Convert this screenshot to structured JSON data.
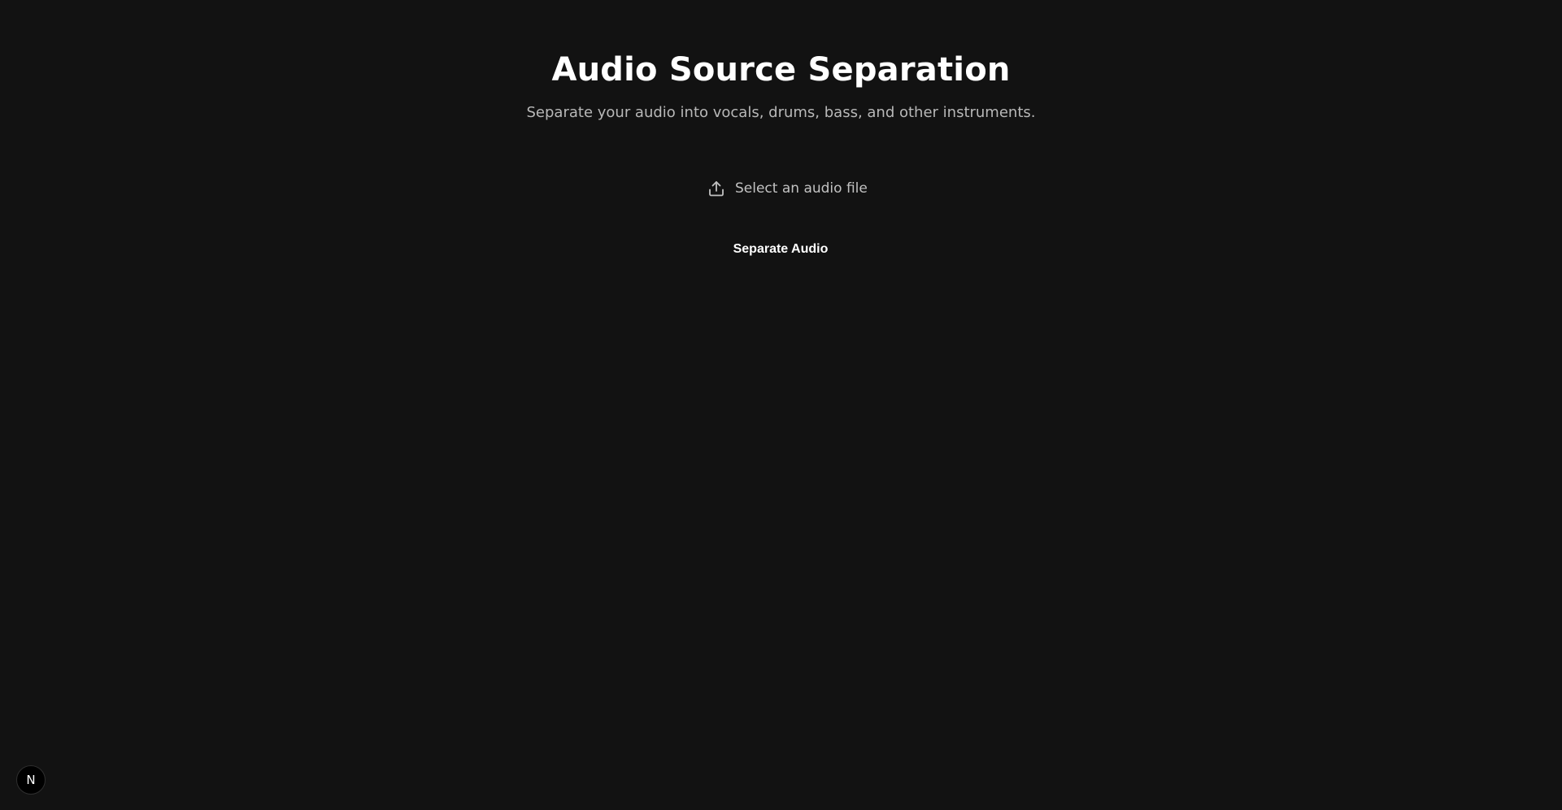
{
  "header": {
    "title": "Audio Source Separation",
    "subtitle": "Separate your audio into vocals, drums, bass, and other instruments."
  },
  "upload": {
    "label": "Select an audio file",
    "icon": "upload-icon"
  },
  "actions": {
    "separate_label": "Separate Audio"
  },
  "dev_badge": {
    "letter": "N",
    "icon": "nextjs-logo-icon"
  },
  "colors": {
    "background": "#121212",
    "title": "#ffffff",
    "subtitle": "#b8b8b8",
    "muted_text": "#c2c2c2"
  }
}
